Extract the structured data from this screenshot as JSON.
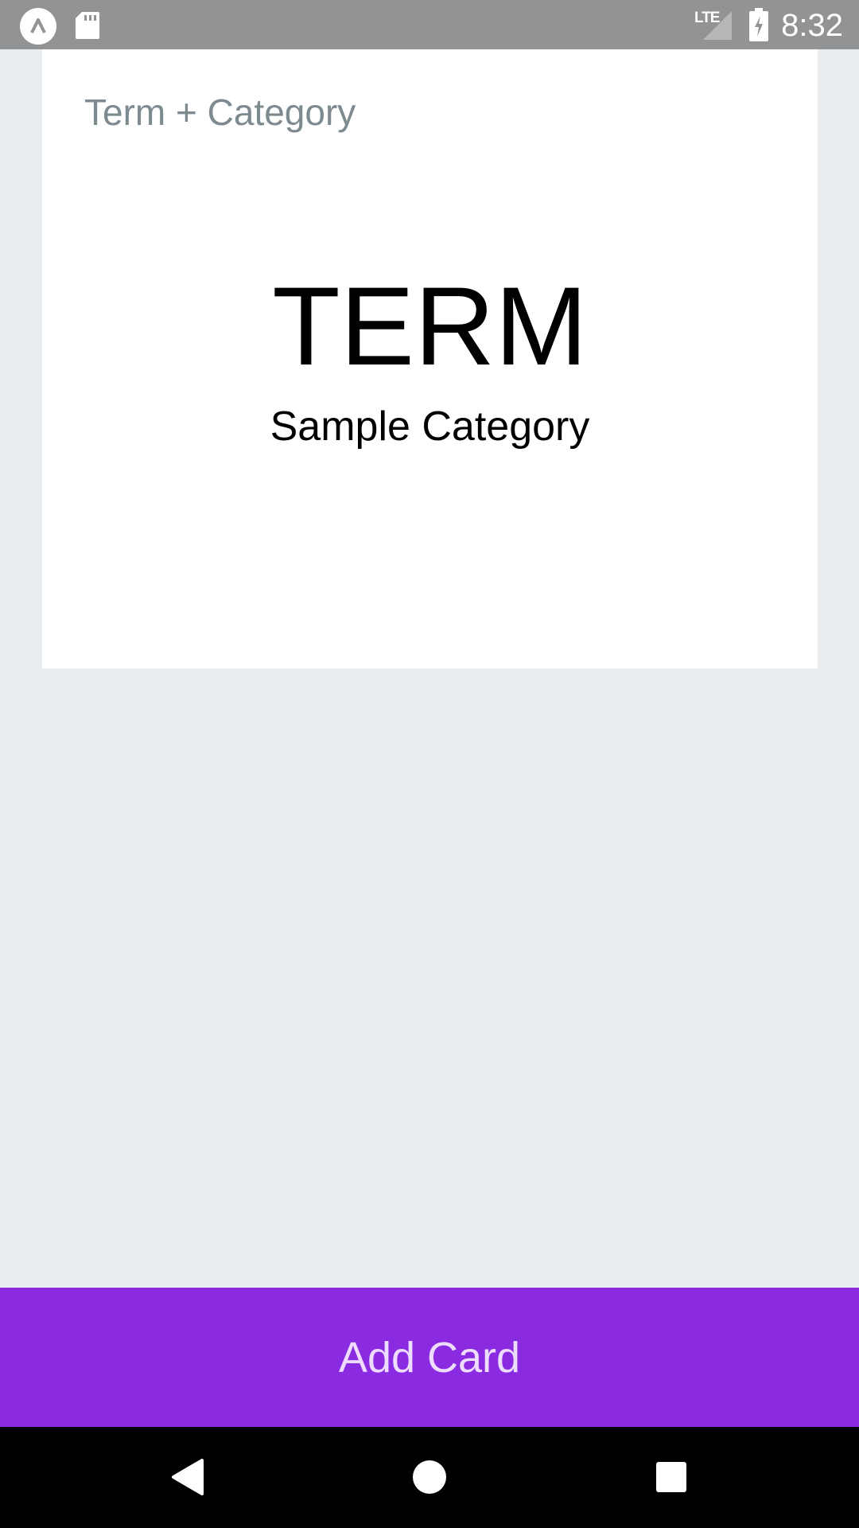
{
  "status_bar": {
    "network": "LTE",
    "time": "8:32",
    "icons": [
      "app-notification-icon",
      "sd-card-icon",
      "signal-icon",
      "battery-charging-icon"
    ]
  },
  "card": {
    "header": "Term + Category",
    "term": "TERM",
    "category": "Sample Category"
  },
  "actions": {
    "add_card_label": "Add Card"
  },
  "nav_bar": {
    "icons": [
      "back-icon",
      "home-icon",
      "recents-icon"
    ]
  },
  "colors": {
    "background": "#e9edef",
    "status_bar": "#919395",
    "accent": "#8a2be2",
    "button_text": "#eedcff",
    "card_header_text": "#7d8a90"
  }
}
